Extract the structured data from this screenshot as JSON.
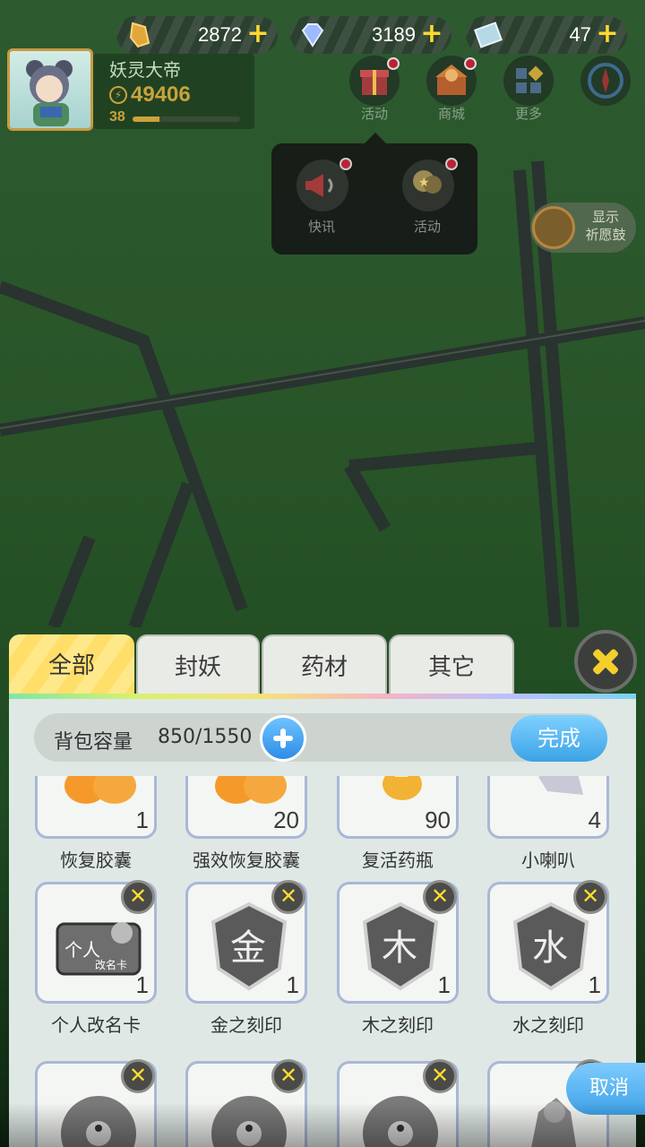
{
  "currencies": [
    {
      "icon": "gold-crystal-icon",
      "value": "2872"
    },
    {
      "icon": "diamond-icon",
      "value": "3189"
    },
    {
      "icon": "ticket-icon",
      "value": "47"
    }
  ],
  "player": {
    "name": "妖灵大帝",
    "power": "49406",
    "level": "38",
    "xp_fraction": 0.25
  },
  "top_menu": [
    {
      "icon": "gift-icon",
      "label": "活动"
    },
    {
      "icon": "shop-icon",
      "label": "商城"
    },
    {
      "icon": "more-icon",
      "label": "更多"
    },
    {
      "icon": "compass-icon",
      "label": ""
    }
  ],
  "popup": [
    {
      "icon": "megaphone-icon",
      "label": "快讯"
    },
    {
      "icon": "balloon-icon",
      "label": "活动"
    }
  ],
  "wish_drum": {
    "label_line1": "显示",
    "label_line2": "祈愿鼓"
  },
  "tabs": [
    "全部",
    "封妖",
    "药材",
    "其它"
  ],
  "capacity": {
    "label": "背包容量",
    "value": "850/1550"
  },
  "done_label": "完成",
  "cancel_label": "取消",
  "items": [
    {
      "name": "恢复胶囊",
      "count": "1",
      "icon": "capsule-icon",
      "deletable": false
    },
    {
      "name": "强效恢复胶囊",
      "count": "20",
      "icon": "capsule-icon",
      "deletable": false
    },
    {
      "name": "复活药瓶",
      "count": "90",
      "icon": "potion-icon",
      "deletable": false
    },
    {
      "name": "小喇叭",
      "count": "4",
      "icon": "horn-icon",
      "deletable": false
    },
    {
      "name": "个人改名卡",
      "count": "1",
      "icon": "rename-card-icon",
      "deletable": true,
      "art_text": "个人",
      "art_subtext": "改名卡"
    },
    {
      "name": "金之刻印",
      "count": "1",
      "icon": "metal-seal-icon",
      "deletable": true,
      "art_text": "金"
    },
    {
      "name": "木之刻印",
      "count": "1",
      "icon": "wood-seal-icon",
      "deletable": true,
      "art_text": "木"
    },
    {
      "name": "水之刻印",
      "count": "1",
      "icon": "water-seal-icon",
      "deletable": true,
      "art_text": "水"
    },
    {
      "name": "",
      "count": "",
      "icon": "yinyang-orb-icon",
      "deletable": true
    },
    {
      "name": "",
      "count": "",
      "icon": "yinyang-orb-icon",
      "deletable": true
    },
    {
      "name": "",
      "count": "",
      "icon": "yinyang-orb-icon",
      "deletable": true
    },
    {
      "name": "",
      "count": "",
      "icon": "statue-icon",
      "deletable": true
    }
  ]
}
